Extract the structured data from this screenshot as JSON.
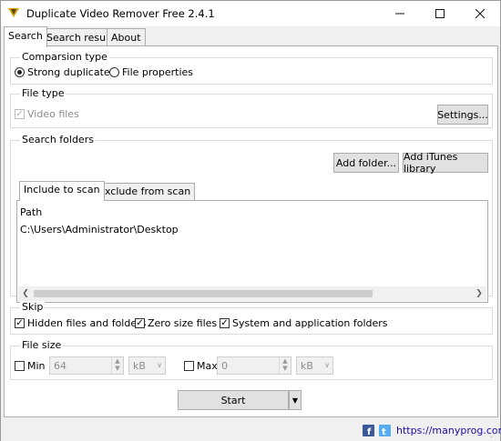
{
  "window": {
    "title": "Duplicate Video Remover Free 2.4.1"
  },
  "tabs": [
    {
      "label": "Search",
      "active": true
    },
    {
      "label": "Search result"
    },
    {
      "label": "About"
    }
  ],
  "comparison": {
    "title": "Comparsion type",
    "options": [
      {
        "label": "Strong duplicate",
        "selected": true
      },
      {
        "label": "File properties",
        "selected": false
      }
    ]
  },
  "file_type": {
    "title": "File type",
    "video_files_label": "Video files",
    "video_files_checked": true,
    "settings_label": "Settings..."
  },
  "search_folders": {
    "title": "Search folders",
    "add_folder_label": "Add folder...",
    "add_itunes_label": "Add iTunes library",
    "tabs": [
      {
        "label": "Include to scan",
        "active": true
      },
      {
        "label": "Exclude from scan"
      }
    ],
    "column_header": "Path",
    "rows": [
      "C:\\Users\\Administrator\\Desktop"
    ]
  },
  "skip": {
    "title": "Skip",
    "options": [
      {
        "label": "Hidden files and folders",
        "checked": true
      },
      {
        "label": "Zero size files",
        "checked": true
      },
      {
        "label": "System and application folders",
        "checked": true
      }
    ]
  },
  "file_size": {
    "title": "File size",
    "min": {
      "label": "Min",
      "checked": false,
      "value": "64",
      "unit": "kB"
    },
    "max": {
      "label": "Max",
      "checked": false,
      "value": "0",
      "unit": "kB"
    }
  },
  "start": {
    "label": "Start"
  },
  "status": {
    "link": "https://manyprog.com"
  },
  "icons": {
    "app": "app-logo-icon",
    "facebook": "facebook-icon",
    "twitter": "twitter-icon"
  },
  "colors": {
    "facebook": "#3b5998",
    "twitter": "#55acee",
    "link": "#1a0dab"
  }
}
